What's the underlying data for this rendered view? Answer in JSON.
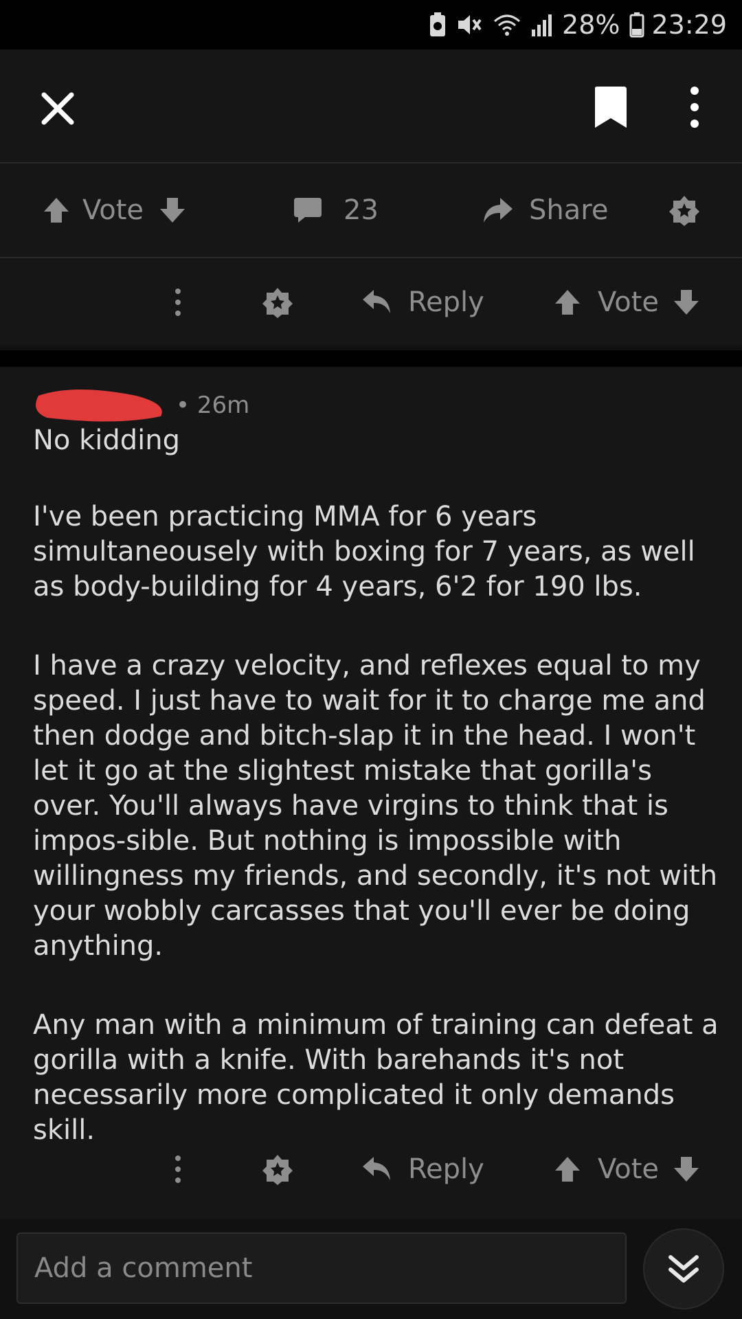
{
  "status_bar": {
    "battery_percent": "28%",
    "time": "23:29",
    "icons": [
      "battery-saver-icon",
      "mute-icon",
      "wifi-icon",
      "signal-icon",
      "battery-icon"
    ]
  },
  "top_nav": {
    "icons": [
      "close-icon",
      "bookmark-icon",
      "more-vertical-icon"
    ]
  },
  "post_actions": {
    "vote_label": "Vote",
    "comment_count": "23",
    "share_label": "Share",
    "icons": [
      "upvote-icon",
      "downvote-icon",
      "comment-icon",
      "share-icon",
      "award-icon"
    ]
  },
  "comment_actions": {
    "reply_label": "Reply",
    "vote_label": "Vote",
    "icons": [
      "more-vertical-icon",
      "award-icon",
      "reply-icon",
      "upvote-icon",
      "downvote-icon"
    ]
  },
  "comment": {
    "age": "• 26m",
    "author_redacted": true,
    "paragraphs": [
      "No kidding",
      "I've been practicing MMA for 6 years simultaneousely with boxing for 7 years, as well as body-building for 4 years, 6'2 for 190 lbs.",
      "I have a crazy velocity, and reflexes equal to my speed. I just have to wait for it to charge me and then dodge and bitch-slap it in the head. I won't let it go at the slightest mistake that gorilla's over. You'll always have virgins to think that is impos-sible. But nothing is impossible with willingness my friends, and secondly, it's not with your wobbly carcasses that you'll ever be doing anything.",
      "Any man with a minimum of training can defeat a gorilla with a knife. With barehands it's not necessarily more complicated it only demands skill."
    ]
  },
  "composer": {
    "placeholder": "Add a comment"
  },
  "colors": {
    "background": "#161617",
    "muted_text": "#8e8e8e",
    "body_text": "#dcdcdc",
    "redaction": "#e03a3a"
  }
}
